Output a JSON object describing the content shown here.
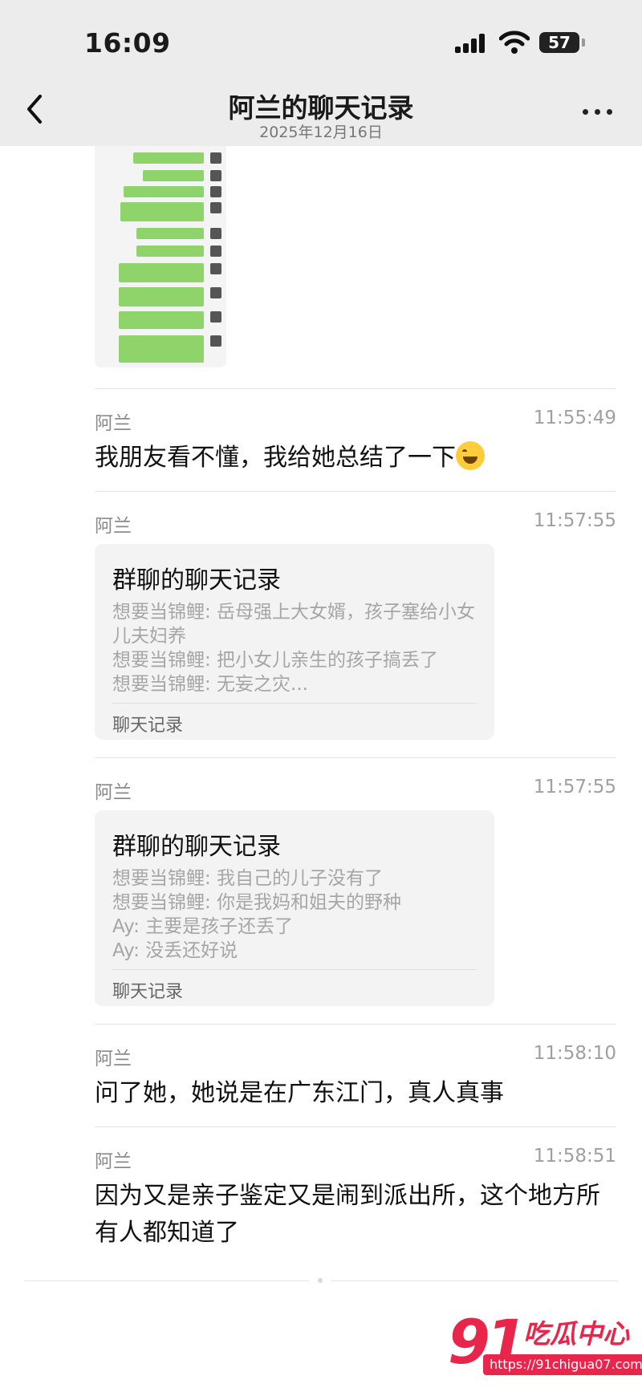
{
  "status_bar": {
    "time": "16:09",
    "battery": "57"
  },
  "header": {
    "title": "阿兰的聊天记录",
    "date": "2025年12月16日"
  },
  "messages": [
    {
      "sender": "阿兰",
      "time": "11:55:49",
      "text": "我朋友看不懂，我给她总结了一下",
      "emoji": "face-with-tears-of-joy"
    },
    {
      "sender": "阿兰",
      "time": "11:57:55",
      "card": {
        "title": "群聊的聊天记录",
        "lines": [
          "想要当锦鲤: 岳母强上大女婿，孩子塞给小女儿夫妇养",
          "想要当锦鲤: 把小女儿亲生的孩子搞丢了",
          "想要当锦鲤: 无妄之灾..."
        ],
        "footer": "聊天记录"
      }
    },
    {
      "sender": "阿兰",
      "time": "11:57:55",
      "card": {
        "title": "群聊的聊天记录",
        "lines": [
          "想要当锦鲤: 我自己的儿子没有了",
          "想要当锦鲤: 你是我妈和姐夫的野种",
          "Ay: 主要是孩子还丢了",
          "Ay: 没丢还好说"
        ],
        "footer": "聊天记录"
      }
    },
    {
      "sender": "阿兰",
      "time": "11:58:10",
      "text": "问了她，她说是在广东江门，真人真事"
    },
    {
      "sender": "阿兰",
      "time": "11:58:51",
      "text": "因为又是亲子鉴定又是闹到派出所，这个地方所有人都知道了"
    }
  ],
  "watermark": {
    "number": "91",
    "name": "吃瓜中心",
    "url": "https://91chigua07.com"
  },
  "colors": {
    "accent": "#e8254b",
    "bubble_green": "#8fd46a",
    "topbar_bg": "#ececec"
  }
}
